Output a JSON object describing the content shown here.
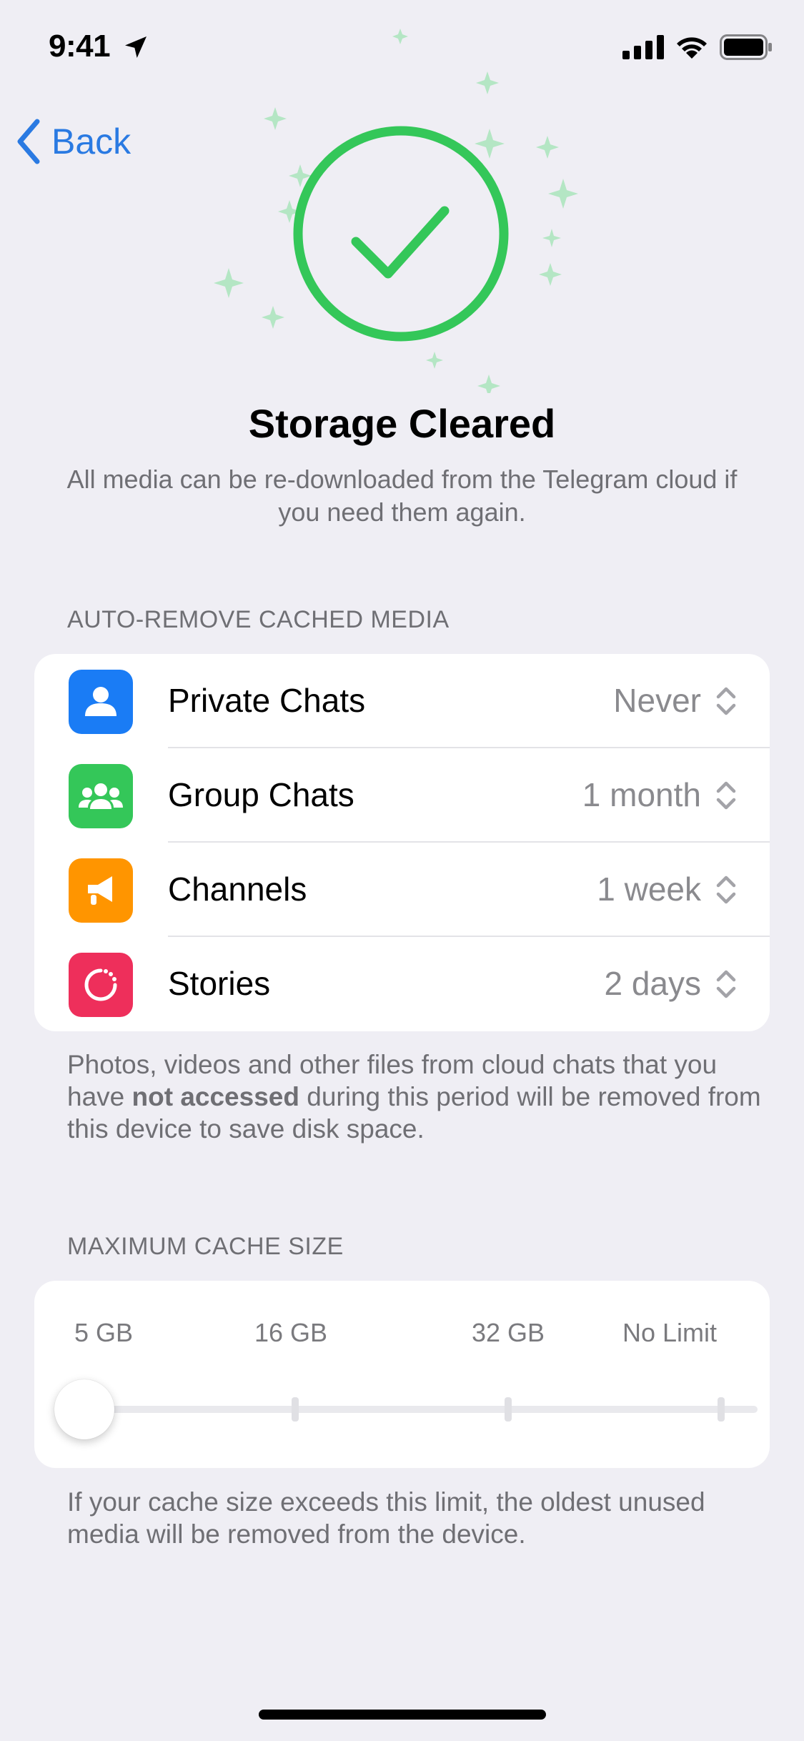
{
  "status_bar": {
    "time": "9:41",
    "icons": [
      "location-arrow-icon",
      "cellular-signal-icon",
      "wifi-icon",
      "battery-icon"
    ]
  },
  "nav": {
    "back_label": "Back"
  },
  "hero": {
    "title": "Storage Cleared",
    "subtitle": "All media can be re-downloaded from the Telegram cloud if you need them again.",
    "accent_color": "#34c759",
    "sparkle_color": "#b4e6c4"
  },
  "auto_remove": {
    "header": "AUTO-REMOVE CACHED MEDIA",
    "rows": [
      {
        "label": "Private Chats",
        "value": "Never",
        "icon": "person-icon",
        "color": "#1a7cf5"
      },
      {
        "label": "Group Chats",
        "value": "1 month",
        "icon": "group-icon",
        "color": "#34c759"
      },
      {
        "label": "Channels",
        "value": "1 week",
        "icon": "megaphone-icon",
        "color": "#ff9500"
      },
      {
        "label": "Stories",
        "value": "2 days",
        "icon": "stories-icon",
        "color": "#ee2f5b"
      }
    ],
    "footer_pre": "Photos, videos and other files from cloud chats that you have ",
    "footer_bold": "not accessed",
    "footer_post": " during this period will be removed from this device to save disk space."
  },
  "cache_size": {
    "header": "MAXIMUM CACHE SIZE",
    "ticks": [
      "5 GB",
      "16 GB",
      "32 GB",
      "No Limit"
    ],
    "selected": "5 GB",
    "footer": "If your cache size exceeds this limit, the oldest unused media will be removed from the device."
  }
}
